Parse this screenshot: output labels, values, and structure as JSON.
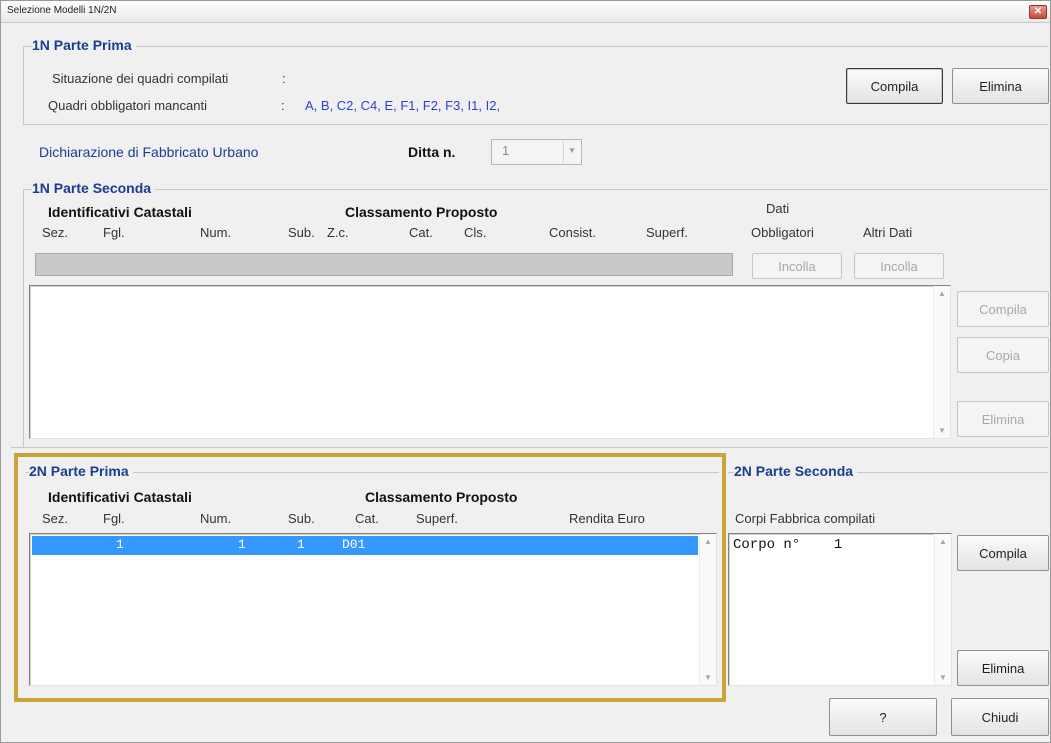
{
  "window": {
    "title": "Selezione Modelli 1N/2N",
    "close": "✕"
  },
  "parte_prima_1n": {
    "title": "1N Parte Prima",
    "situazione_label": "Situazione dei quadri compilati",
    "situazione_sep": ":",
    "mancanti_label": "Quadri obbligatori mancanti",
    "mancanti_sep": ":",
    "mancanti_value": "A, B, C2, C4, E, F1, F2, F3, I1, I2,",
    "compila": "Compila",
    "elimina": "Elimina"
  },
  "dichiarazione": {
    "label": "Dichiarazione di Fabbricato Urbano",
    "ditta_label": "Ditta n.",
    "ditta_value": "1"
  },
  "parte_seconda_1n": {
    "title": "1N Parte Seconda",
    "group_ident": "Identificativi Catastali",
    "group_class": "Classamento Proposto",
    "col_sez": "Sez.",
    "col_fgl": "Fgl.",
    "col_num": "Num.",
    "col_sub": "Sub.",
    "col_zc": "Z.c.",
    "col_cat": "Cat.",
    "col_cls": "Cls.",
    "col_consist": "Consist.",
    "col_superf": "Superf.",
    "dati_line1": "Dati",
    "dati_line2": "Obbligatori",
    "altri_dati": "Altri Dati",
    "incolla1": "Incolla",
    "incolla2": "Incolla",
    "compila": "Compila",
    "copia": "Copia",
    "elimina": "Elimina"
  },
  "parte_prima_2n": {
    "title": "2N Parte Prima",
    "group_ident": "Identificativi Catastali",
    "group_class": "Classamento Proposto",
    "col_sez": "Sez.",
    "col_fgl": "Fgl.",
    "col_num": "Num.",
    "col_sub": "Sub.",
    "col_cat": "Cat.",
    "col_superf": "Superf.",
    "col_rendita": "Rendita Euro",
    "rows": [
      {
        "fgl": "1",
        "num": "1",
        "sub": "1",
        "cat": "D01"
      }
    ]
  },
  "parte_seconda_2n": {
    "title": "2N Parte Seconda",
    "corpi_label": "Corpi Fabbrica compilati",
    "corpi_items": [
      "Corpo n°    1"
    ],
    "compila": "Compila",
    "elimina": "Elimina"
  },
  "footer": {
    "help": "?",
    "chiudi": "Chiudi"
  },
  "colors": {
    "accent_frame": "#c9a43a",
    "title_blue": "#1a3d8f",
    "selection": "#3399ff",
    "link_blue": "#2b3fd6"
  }
}
